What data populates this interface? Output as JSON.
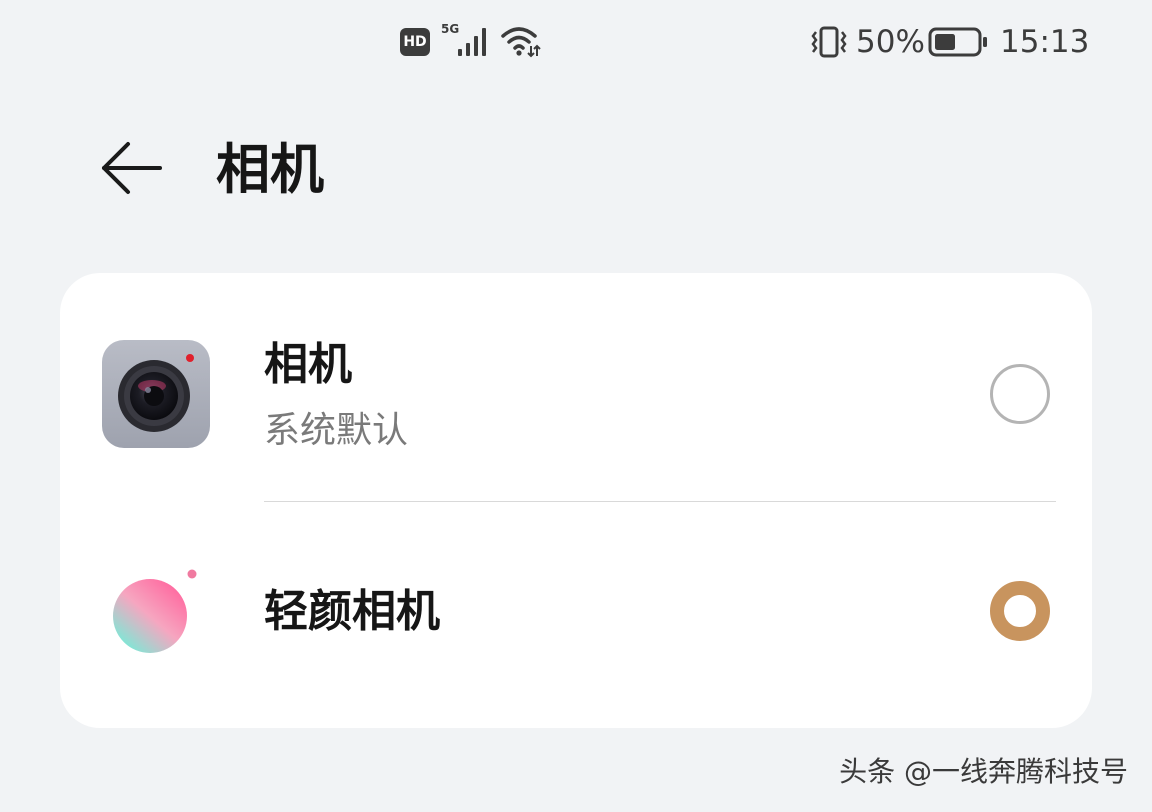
{
  "status_bar": {
    "hd_label": "HD",
    "network_label": "5G",
    "battery_percent": "50%",
    "battery_level": 0.5,
    "time": "15:13"
  },
  "header": {
    "title": "相机",
    "back_icon": "arrow-left-icon"
  },
  "options": [
    {
      "title": "相机",
      "subtitle": "系统默认",
      "icon": "camera-app-icon",
      "selected": false
    },
    {
      "title": "轻颜相机",
      "icon": "beauty-camera-app-icon",
      "selected": true
    }
  ],
  "watermark": "头条 @一线奔腾科技号",
  "colors": {
    "background": "#f1f3f5",
    "card": "#ffffff",
    "accent": "#c8945e",
    "radio_unselected": "#b4b4b4",
    "subtitle": "#7a7a7a"
  }
}
